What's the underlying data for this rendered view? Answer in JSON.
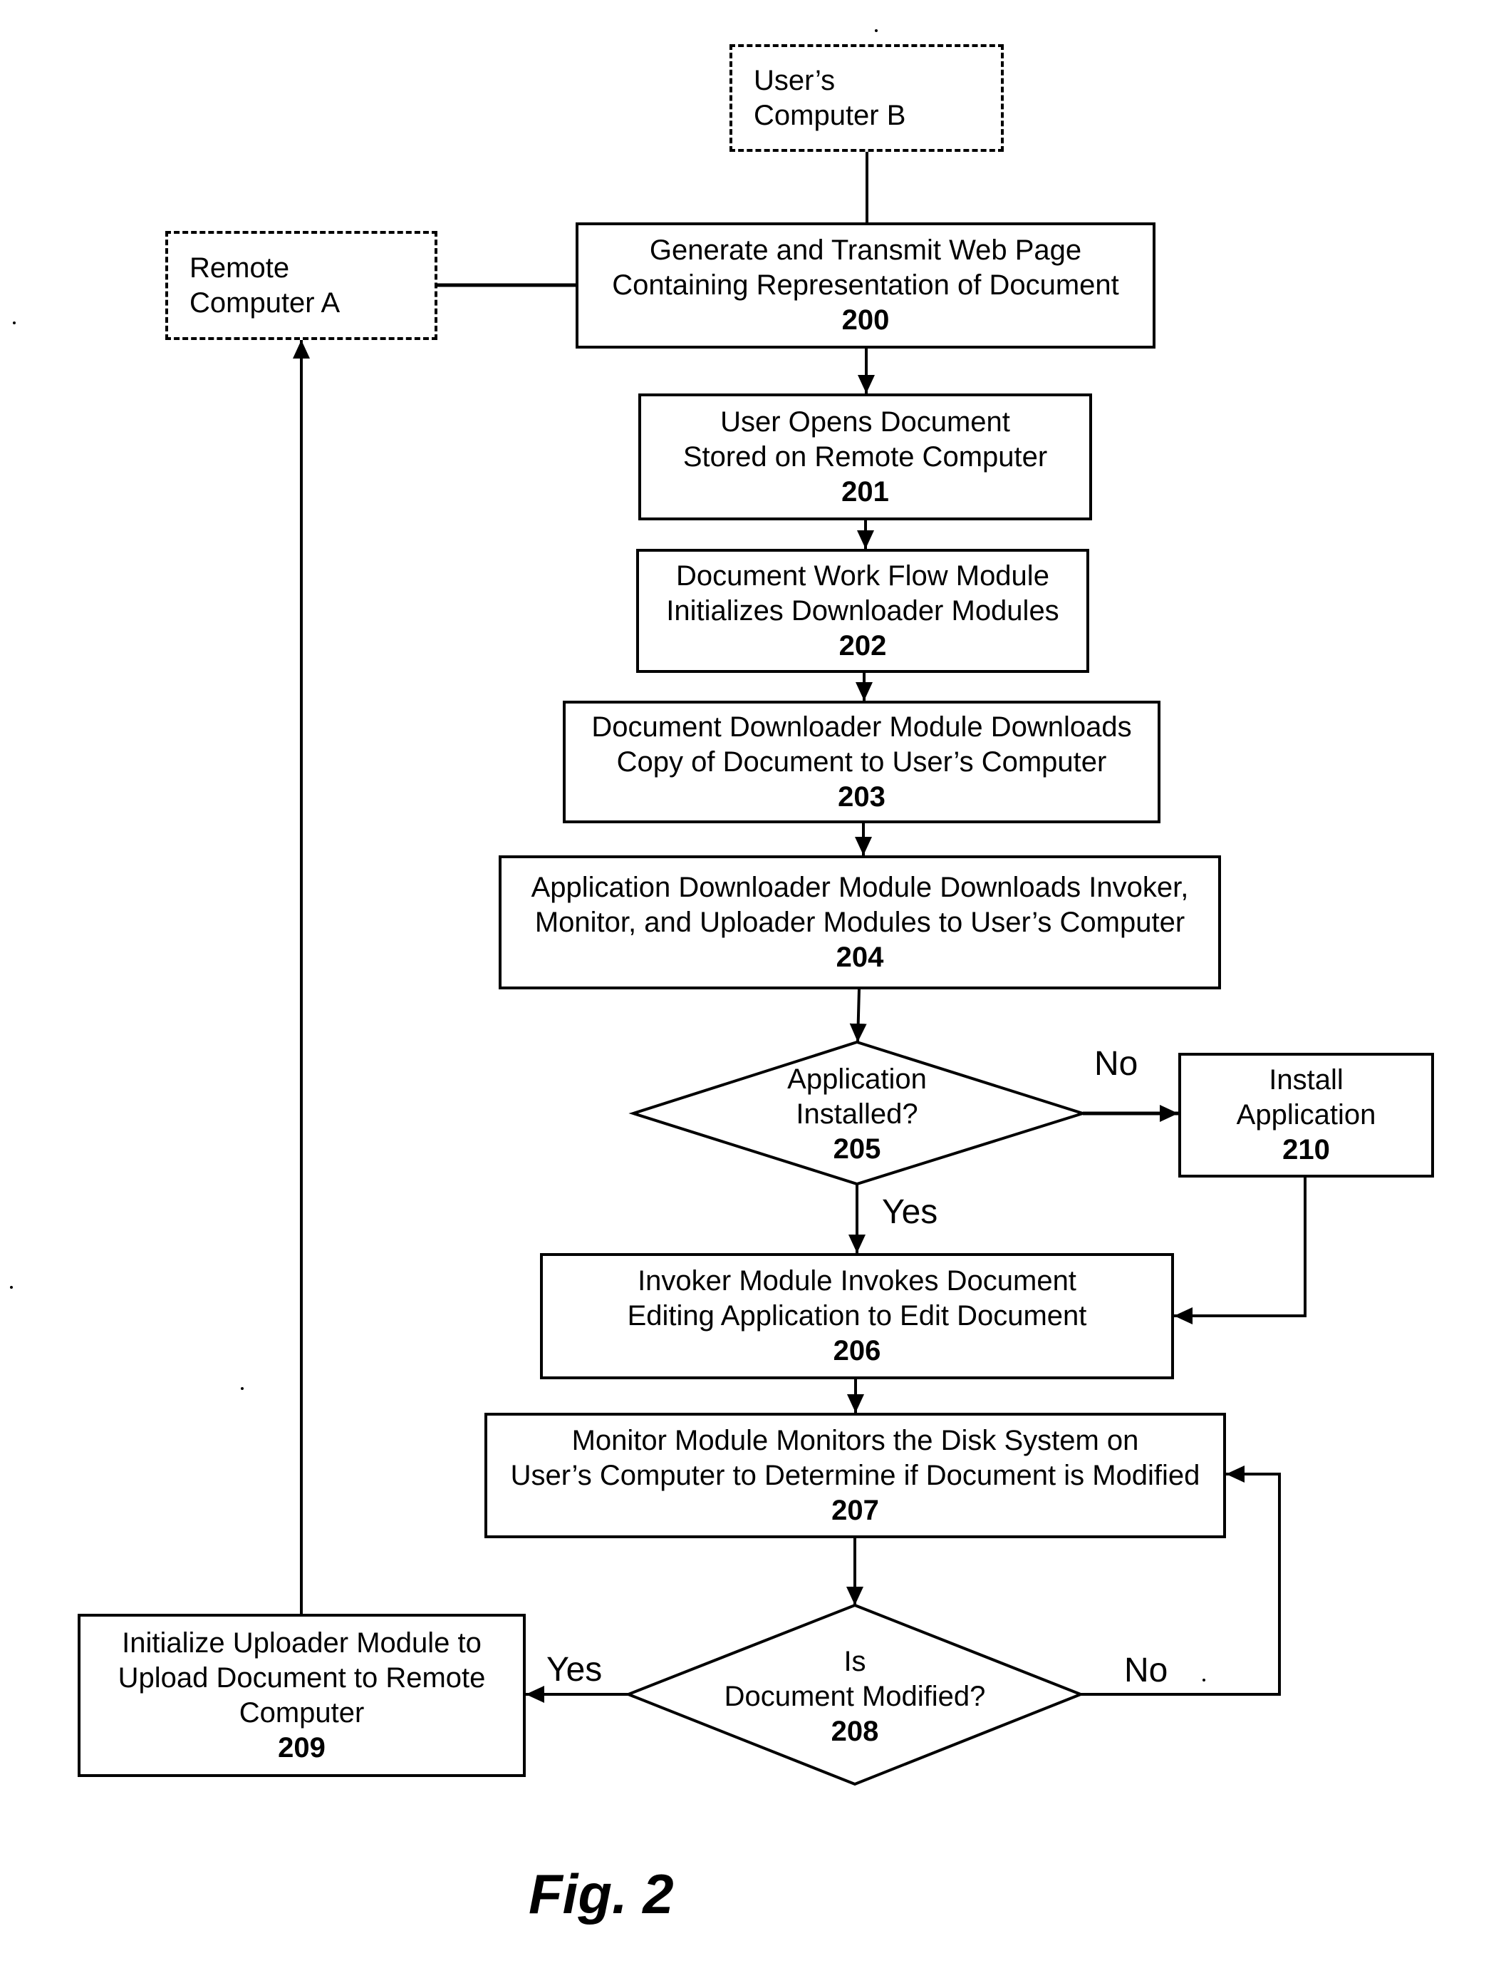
{
  "figure": {
    "caption": "Fig. 2"
  },
  "colors": {
    "ink": "#000000",
    "paper": "#ffffff"
  },
  "nodes": {
    "users_computer_b": {
      "lines": [
        "User’s",
        "Computer B"
      ],
      "style": "dashed"
    },
    "remote_computer_a": {
      "lines": [
        "Remote",
        "Computer A"
      ],
      "style": "dashed"
    },
    "step_200": {
      "lines": [
        "Generate and Transmit Web Page",
        "Containing Representation of Document"
      ],
      "number": "200"
    },
    "step_201": {
      "lines": [
        "User Opens Document",
        "Stored on Remote Computer"
      ],
      "number": "201"
    },
    "step_202": {
      "lines": [
        "Document Work Flow Module",
        "Initializes Downloader Modules"
      ],
      "number": "202"
    },
    "step_203": {
      "lines": [
        "Document Downloader Module Downloads",
        "Copy of Document to User’s Computer"
      ],
      "number": "203"
    },
    "step_204": {
      "lines": [
        "Application Downloader Module Downloads Invoker,",
        "Monitor, and Uploader Modules to User’s Computer"
      ],
      "number": "204"
    },
    "decision_205": {
      "lines": [
        "Application",
        "Installed?"
      ],
      "number": "205",
      "shape": "diamond"
    },
    "step_206": {
      "lines": [
        "Invoker Module Invokes Document",
        "Editing Application to Edit Document"
      ],
      "number": "206"
    },
    "step_207": {
      "lines": [
        "Monitor Module Monitors the Disk System on",
        "User’s Computer to Determine if Document is Modified"
      ],
      "number": "207"
    },
    "decision_208": {
      "lines": [
        "Is",
        "Document Modified?"
      ],
      "number": "208",
      "shape": "diamond"
    },
    "step_209": {
      "lines": [
        "Initialize Uploader Module to",
        "Upload Document to Remote",
        "Computer"
      ],
      "number": "209"
    },
    "step_210": {
      "lines": [
        "Install",
        "Application"
      ],
      "number": "210"
    }
  },
  "edge_labels": {
    "d205_no": "No",
    "d205_yes": "Yes",
    "d208_yes": "Yes",
    "d208_no": "No"
  },
  "edges": [
    {
      "from": "users_computer_b",
      "to": "step_200",
      "arrow": false
    },
    {
      "from": "step_200",
      "to": "remote_computer_a",
      "arrow": false
    },
    {
      "from": "step_200",
      "to": "step_201",
      "arrow": true
    },
    {
      "from": "step_201",
      "to": "step_202",
      "arrow": true
    },
    {
      "from": "step_202",
      "to": "step_203",
      "arrow": true
    },
    {
      "from": "step_203",
      "to": "step_204",
      "arrow": true
    },
    {
      "from": "step_204",
      "to": "decision_205",
      "arrow": true
    },
    {
      "from": "decision_205",
      "to": "step_210",
      "label": "No",
      "arrow": true
    },
    {
      "from": "decision_205",
      "to": "step_206",
      "label": "Yes",
      "arrow": true
    },
    {
      "from": "step_210",
      "to": "step_206",
      "arrow": true
    },
    {
      "from": "step_206",
      "to": "step_207",
      "arrow": true
    },
    {
      "from": "step_207",
      "to": "decision_208",
      "arrow": true
    },
    {
      "from": "decision_208",
      "to": "step_209",
      "label": "Yes",
      "arrow": true
    },
    {
      "from": "decision_208",
      "to": "step_207",
      "label": "No",
      "arrow": true
    },
    {
      "from": "step_209",
      "to": "remote_computer_a",
      "arrow": true
    }
  ]
}
